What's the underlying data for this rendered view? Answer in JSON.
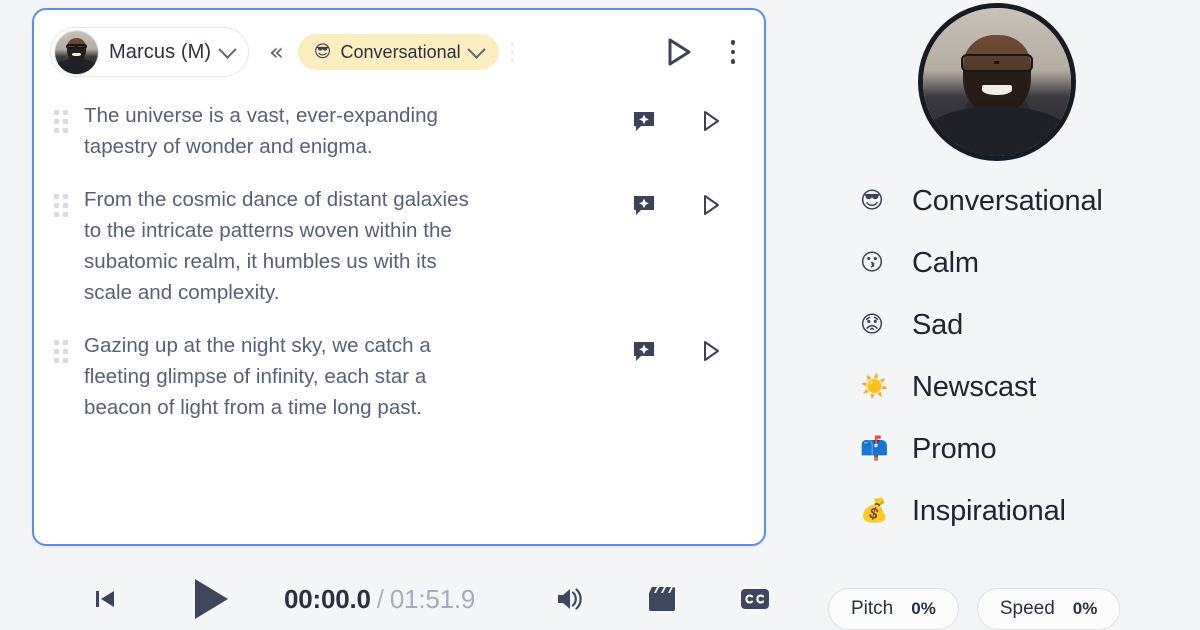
{
  "colors": {
    "page_bg": "#f4f5f7",
    "card_border": "#5b8def",
    "chip_bg": "#fdeec0",
    "text_primary": "#2c3142",
    "text_body": "#56607a",
    "icon_dark": "#3c4257"
  },
  "editor": {
    "speaker": {
      "name": "Marcus (M)",
      "dropdown_icon": "chevron-down-icon",
      "avatar": "speaker-avatar"
    },
    "collapse_icon": "chevron-double-left-icon",
    "emotion_chip": {
      "emoji": "😎",
      "label": "Conversational",
      "dropdown_icon": "chevron-down-icon"
    },
    "preview_play_icon": "play-outline-icon",
    "more_icon": "kebab-menu-icon",
    "sentences": [
      {
        "text": "The universe is a vast, ever-expanding tapestry of wonder and enigma.",
        "drag_icon": "drag-handle-icon",
        "enhance_icon": "sparkle-bubble-icon",
        "play_icon": "play-outline-icon"
      },
      {
        "text": "From the cosmic dance of distant galaxies to the intricate patterns woven within the subatomic realm, it humbles us with its scale and complexity.",
        "drag_icon": "drag-handle-icon",
        "enhance_icon": "sparkle-bubble-icon",
        "play_icon": "play-outline-icon"
      },
      {
        "text": "Gazing up at the night sky, we catch a fleeting glimpse of infinity, each star a beacon of light from a time long past.",
        "drag_icon": "drag-handle-icon",
        "enhance_icon": "sparkle-bubble-icon",
        "play_icon": "play-outline-icon"
      }
    ]
  },
  "transport": {
    "restart_icon": "skip-to-start-icon",
    "play_icon": "play-filled-icon",
    "current_time": "00:00.0",
    "separator": "/",
    "total_time": "01:51.9",
    "volume_icon": "volume-icon",
    "clapperboard_icon": "clapperboard-icon",
    "captions_icon": "closed-captions-icon"
  },
  "panel": {
    "avatar": "speaker-portrait",
    "emotions": [
      {
        "emoji": "😎",
        "label": "Conversational"
      },
      {
        "emoji": "😗",
        "label": "Calm"
      },
      {
        "emoji": "😟",
        "label": "Sad"
      },
      {
        "emoji": "☀️",
        "label": "Newscast"
      },
      {
        "emoji": "📫",
        "label": "Promo"
      },
      {
        "emoji": "💰",
        "label": "Inspirational"
      }
    ],
    "controls": [
      {
        "label": "Pitch",
        "value": "0%"
      },
      {
        "label": "Speed",
        "value": "0%"
      }
    ]
  }
}
